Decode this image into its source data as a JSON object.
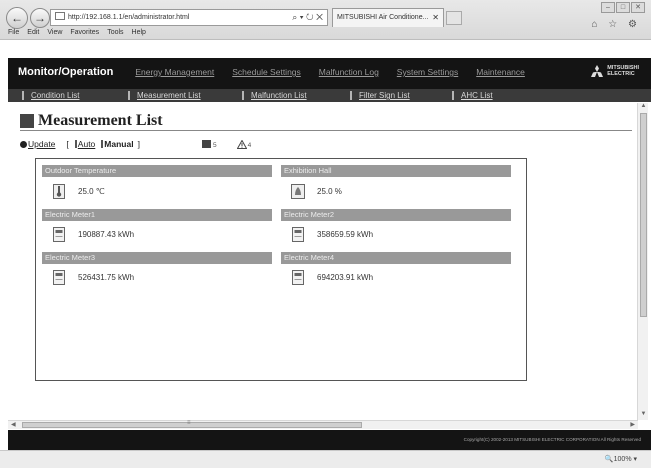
{
  "browser": {
    "address": "http://192.168.1.1/en/administrator.html",
    "address_controls": "⌕ ▾ ↻ ✕",
    "tab_title": "MITSUBISHI Air Conditione...",
    "tab_close": "✕",
    "window_controls": [
      "–",
      "□",
      "✕"
    ],
    "toolbar_icons": "⌂ ☆ ⚙",
    "menu": [
      "File",
      "Edit",
      "View",
      "Favorites",
      "Tools",
      "Help"
    ],
    "zoom": "🔍100%  ▾"
  },
  "nav": {
    "items": [
      "Monitor/Operation",
      "Energy Management",
      "Schedule Settings",
      "Malfunction Log",
      "System Settings",
      "Maintenance"
    ]
  },
  "logo": {
    "line1": "MITSUBISHI",
    "line2": "ELECTRIC"
  },
  "subnav": {
    "items": [
      "Condition List",
      "Measurement List",
      "Malfunction List",
      "Filter Sign List",
      "AHC List"
    ]
  },
  "page": {
    "title": "Measurement List",
    "update_label": "Update",
    "bracket_open": "[",
    "auto_label": "Auto",
    "manual_label": "Manual",
    "bracket_close": "]",
    "stop_count": "5",
    "warning_count": "4"
  },
  "measurements": [
    {
      "name": "Outdoor Temperature",
      "value": "25.0 ℃",
      "icon": "thermometer-icon"
    },
    {
      "name": "Exhibition Hall",
      "value": "25.0 %",
      "icon": "humidity-icon"
    },
    {
      "name": "Electric Meter1",
      "value": "190887.43 kWh",
      "icon": "meter-icon"
    },
    {
      "name": "Electric Meter2",
      "value": "358659.59 kWh",
      "icon": "meter-icon"
    },
    {
      "name": "Electric Meter3",
      "value": "526431.75 kWh",
      "icon": "meter-icon"
    },
    {
      "name": "Electric Meter4",
      "value": "694203.91 kWh",
      "icon": "meter-icon"
    }
  ],
  "scroll": {
    "left": "◀",
    "right": "▶",
    "up": "▲",
    "down": "▼",
    "grip": "≡"
  },
  "footer": {
    "copyright": "Copyright(C) 2002-2013 MITSUBISHI ELECTRIC CORPORATION All Rights Reserved"
  }
}
